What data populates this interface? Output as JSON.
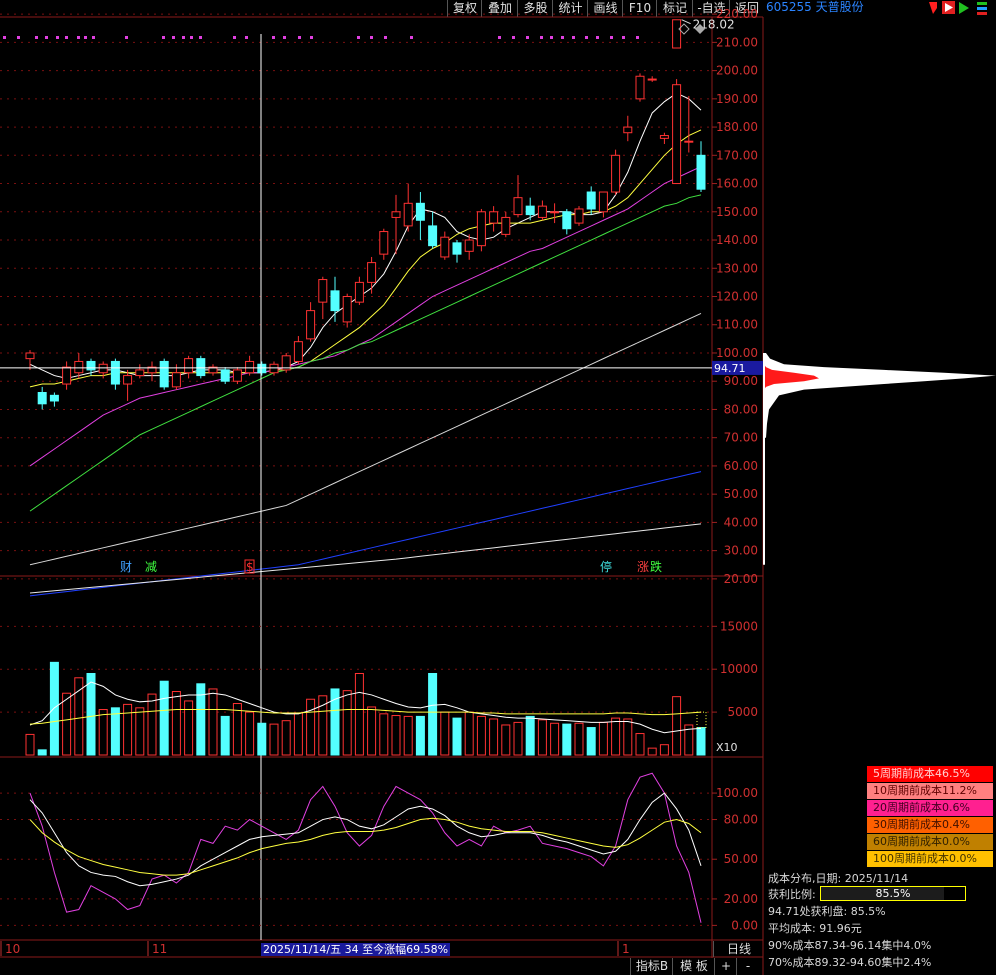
{
  "toolbar": {
    "items": [
      "复权",
      "叠加",
      "多股",
      "统计",
      "画线",
      "F10",
      "标记",
      "-自选",
      "返回"
    ]
  },
  "stock": {
    "code_name": "605255 天普股份"
  },
  "main_chart": {
    "y_ticks": [
      "220.00",
      "210.00",
      "200.00",
      "190.00",
      "180.00",
      "170.00",
      "160.00",
      "150.00",
      "140.00",
      "130.00",
      "120.00",
      "110.00",
      "100.00",
      "90.00",
      "80.00",
      "70.00",
      "60.00",
      "50.00",
      "40.00",
      "30.00",
      "20.00"
    ],
    "high_label": "218.02",
    "current_price_tag": "94.71",
    "event_marks": [
      {
        "text": "财",
        "color": "#40a0ff"
      },
      {
        "text": "减",
        "color": "#40ff40"
      },
      {
        "text": "$",
        "color": "#ff3030"
      },
      {
        "text": "停",
        "color": "#40e0e0"
      },
      {
        "text": "涨",
        "color": "#ff4040"
      },
      {
        "text": "跌",
        "color": "#40ff40"
      }
    ]
  },
  "volume_chart": {
    "y_ticks": [
      "15000",
      "10000",
      "5000"
    ],
    "unit": "X10"
  },
  "indicator_chart": {
    "y_ticks": [
      "100.00",
      "80.00",
      "50.00",
      "20.00",
      "0.00"
    ]
  },
  "x_axis": {
    "labels": [
      "10",
      "11",
      "1"
    ],
    "status_text": "2025/11/14/五 34 至今涨幅69.58%",
    "period": "日线"
  },
  "bottom_tabs": [
    "指标B",
    "模 板",
    "+",
    "-"
  ],
  "cost_distribution": {
    "legend": [
      {
        "label": "5周期前成本46.5%",
        "bg": "#ff0000",
        "fg": "#ffd0d0"
      },
      {
        "label": "10周期前成本11.2%",
        "bg": "#ff8080",
        "fg": "#600000"
      },
      {
        "label": "20周期前成本0.6%",
        "bg": "#ff2090",
        "fg": "#400020"
      },
      {
        "label": "30周期前成本0.4%",
        "bg": "#ff6000",
        "fg": "#401000"
      },
      {
        "label": "60周期前成本0.0%",
        "bg": "#c08000",
        "fg": "#302000"
      },
      {
        "label": "100周期前成本0.0%",
        "bg": "#ffc000",
        "fg": "#403000"
      }
    ],
    "date_line": "成本分布,日期: 2025/11/14",
    "profit_ratio_label": "获利比例:",
    "profit_ratio_value": "85.5%",
    "profit_ratio_fraction": 0.855,
    "profit_at_price": "94.71处获利盘: 85.5%",
    "avg_cost": "平均成本: 91.96元",
    "cost90": "90%成本87.34-96.14集中4.0%",
    "cost70": "70%成本89.32-94.60集中2.4%"
  },
  "chart_data": {
    "type": "candlestick",
    "y_axis_range": [
      15,
      225
    ],
    "candles": [
      {
        "o": 98,
        "c": 100,
        "h": 101,
        "l": 94
      },
      {
        "o": 86,
        "c": 82,
        "h": 88,
        "l": 80
      },
      {
        "o": 85,
        "c": 83,
        "h": 86,
        "l": 81
      },
      {
        "o": 89,
        "c": 95,
        "h": 97,
        "l": 87
      },
      {
        "o": 93,
        "c": 97,
        "h": 100,
        "l": 91
      },
      {
        "o": 97,
        "c": 94,
        "h": 98,
        "l": 92
      },
      {
        "o": 93,
        "c": 96,
        "h": 97,
        "l": 91
      },
      {
        "o": 97,
        "c": 89,
        "h": 98,
        "l": 87
      },
      {
        "o": 89,
        "c": 92,
        "h": 94,
        "l": 83
      },
      {
        "o": 92,
        "c": 94,
        "h": 96,
        "l": 91
      },
      {
        "o": 93,
        "c": 95,
        "h": 97,
        "l": 90
      },
      {
        "o": 97,
        "c": 88,
        "h": 98,
        "l": 87
      },
      {
        "o": 88,
        "c": 93,
        "h": 96,
        "l": 87
      },
      {
        "o": 93,
        "c": 98,
        "h": 99,
        "l": 91
      },
      {
        "o": 98,
        "c": 92,
        "h": 99,
        "l": 91
      },
      {
        "o": 93,
        "c": 95,
        "h": 96,
        "l": 92
      },
      {
        "o": 94,
        "c": 90,
        "h": 95,
        "l": 89
      },
      {
        "o": 90,
        "c": 94,
        "h": 95,
        "l": 89
      },
      {
        "o": 93,
        "c": 97,
        "h": 99,
        "l": 92
      },
      {
        "o": 96,
        "c": 93,
        "h": 97,
        "l": 92
      },
      {
        "o": 93,
        "c": 96,
        "h": 97,
        "l": 92
      },
      {
        "o": 94,
        "c": 99,
        "h": 100,
        "l": 93
      },
      {
        "o": 97,
        "c": 104,
        "h": 106,
        "l": 96
      },
      {
        "o": 105,
        "c": 115,
        "h": 118,
        "l": 104
      },
      {
        "o": 118,
        "c": 126,
        "h": 127,
        "l": 112
      },
      {
        "o": 122,
        "c": 115,
        "h": 127,
        "l": 111
      },
      {
        "o": 111,
        "c": 120,
        "h": 121,
        "l": 109
      },
      {
        "o": 118,
        "c": 125,
        "h": 127,
        "l": 117
      },
      {
        "o": 125,
        "c": 132,
        "h": 134,
        "l": 121
      },
      {
        "o": 135,
        "c": 143,
        "h": 144,
        "l": 133
      },
      {
        "o": 148,
        "c": 150,
        "h": 156,
        "l": 135
      },
      {
        "o": 145,
        "c": 153,
        "h": 160,
        "l": 143
      },
      {
        "o": 153,
        "c": 147,
        "h": 157,
        "l": 140
      },
      {
        "o": 145,
        "c": 138,
        "h": 150,
        "l": 137
      },
      {
        "o": 134,
        "c": 141,
        "h": 143,
        "l": 133
      },
      {
        "o": 139,
        "c": 135,
        "h": 140,
        "l": 132
      },
      {
        "o": 136,
        "c": 140,
        "h": 142,
        "l": 133
      },
      {
        "o": 138,
        "c": 150,
        "h": 151,
        "l": 136
      },
      {
        "o": 146,
        "c": 150,
        "h": 152,
        "l": 143
      },
      {
        "o": 142,
        "c": 148,
        "h": 150,
        "l": 141
      },
      {
        "o": 149,
        "c": 155,
        "h": 163,
        "l": 148
      },
      {
        "o": 152,
        "c": 149,
        "h": 155,
        "l": 147
      },
      {
        "o": 148,
        "c": 152,
        "h": 154,
        "l": 147
      },
      {
        "o": 150,
        "c": 150,
        "h": 153,
        "l": 146
      },
      {
        "o": 150,
        "c": 144,
        "h": 151,
        "l": 142
      },
      {
        "o": 146,
        "c": 151,
        "h": 152,
        "l": 145
      },
      {
        "o": 157,
        "c": 151,
        "h": 159,
        "l": 149
      },
      {
        "o": 150,
        "c": 157,
        "h": 157,
        "l": 148
      },
      {
        "o": 157,
        "c": 170,
        "h": 172,
        "l": 156
      },
      {
        "o": 178,
        "c": 180,
        "h": 184,
        "l": 175
      },
      {
        "o": 190,
        "c": 198,
        "h": 199,
        "l": 189
      },
      {
        "o": 197,
        "c": 197,
        "h": 198,
        "l": 196
      },
      {
        "o": 176,
        "c": 177,
        "h": 178,
        "l": 174
      },
      {
        "o": 160,
        "c": 195,
        "h": 197,
        "l": 160
      },
      {
        "o": 175,
        "c": 175,
        "h": 191,
        "l": 171
      },
      {
        "o": 170,
        "c": 158,
        "h": 175,
        "l": 157
      }
    ],
    "high_marker": {
      "x_index": 53,
      "price": 218.02,
      "o": 208,
      "c": 218
    },
    "ma_lines": [
      {
        "name": "MA5",
        "color": "#ffffff",
        "values": [
          96,
          94,
          92,
          91,
          92,
          93,
          94,
          94,
          93,
          92,
          92,
          92,
          92,
          93,
          94,
          94,
          94,
          93,
          93,
          93,
          94,
          95,
          97,
          102,
          109,
          114,
          117,
          120,
          123,
          128,
          136,
          145,
          151,
          150,
          148,
          143,
          141,
          140,
          141,
          144,
          146,
          148,
          150,
          150,
          150,
          149,
          149,
          150,
          156,
          164,
          175,
          185,
          189,
          192,
          190,
          186
        ]
      },
      {
        "name": "MA10",
        "color": "#ffff40",
        "values": [
          88,
          89,
          89,
          90,
          91,
          92,
          92,
          93,
          93,
          93,
          93,
          93,
          93,
          93,
          93,
          93,
          93,
          93,
          93,
          93,
          94,
          94,
          95,
          97,
          100,
          103,
          106,
          109,
          113,
          117,
          123,
          129,
          134,
          137,
          139,
          142,
          144,
          145,
          146,
          146,
          146,
          146,
          147,
          148,
          149,
          149,
          150,
          150,
          152,
          155,
          160,
          165,
          170,
          174,
          177,
          179
        ]
      },
      {
        "name": "MA20",
        "color": "#e040e0",
        "values": [
          60,
          63,
          66,
          69,
          72,
          75,
          78,
          80,
          82,
          84,
          85,
          86,
          87,
          88,
          89,
          90,
          91,
          92,
          93,
          93,
          94,
          95,
          96,
          97,
          98,
          99,
          101,
          103,
          105,
          108,
          111,
          114,
          117,
          120,
          122,
          124,
          126,
          128,
          130,
          132,
          134,
          136,
          137,
          139,
          141,
          143,
          145,
          147,
          149,
          151,
          154,
          157,
          160,
          162,
          164,
          166
        ]
      },
      {
        "name": "MA30",
        "color": "#40e040",
        "values": [
          44,
          47,
          50,
          53,
          56,
          59,
          62,
          65,
          68,
          71,
          73,
          75,
          77,
          79,
          81,
          83,
          85,
          87,
          89,
          91,
          93,
          94,
          95,
          97,
          98,
          100,
          101,
          103,
          104,
          106,
          108,
          110,
          112,
          114,
          116,
          118,
          120,
          122,
          124,
          126,
          128,
          130,
          132,
          134,
          136,
          138,
          140,
          142,
          144,
          146,
          148,
          150,
          152,
          153,
          155,
          156
        ]
      },
      {
        "name": "MA60",
        "color": "#d8d8d8",
        "values": [
          25,
          26,
          27,
          28,
          29,
          30,
          31,
          32,
          33,
          34,
          35,
          36,
          37,
          38,
          39,
          40,
          41,
          42,
          43,
          44,
          45,
          46,
          48,
          50,
          52,
          54,
          56,
          58,
          60,
          62,
          64,
          66,
          68,
          70,
          72,
          74,
          76,
          78,
          80,
          82,
          84,
          86,
          88,
          90,
          92,
          94,
          96,
          98,
          100,
          102,
          104,
          106,
          108,
          110,
          112,
          114
        ]
      },
      {
        "name": "MA120",
        "color": "#2040ff",
        "values": [
          14,
          14.5,
          15,
          15.5,
          16,
          16.5,
          17,
          17.5,
          18,
          18.5,
          19,
          19.5,
          20,
          20.5,
          21,
          21.5,
          22,
          22.5,
          23,
          23.5,
          24,
          24.5,
          25,
          26,
          27,
          28,
          29,
          30,
          31,
          32,
          33,
          34,
          35,
          36,
          37,
          38,
          39,
          40,
          41,
          42,
          43,
          44,
          45,
          46,
          47,
          48,
          49,
          50,
          51,
          52,
          53,
          54,
          55,
          56,
          57,
          58
        ]
      },
      {
        "name": "MA250",
        "color": "#e8e8e8",
        "values": [
          15,
          15.4,
          15.8,
          16.2,
          16.6,
          17,
          17.4,
          17.8,
          18.2,
          18.6,
          19,
          19.4,
          19.8,
          20.2,
          20.6,
          21,
          21.4,
          21.8,
          22.2,
          22.6,
          23,
          23.4,
          23.8,
          24.2,
          24.6,
          25,
          25.4,
          25.8,
          26.2,
          26.6,
          27,
          27.5,
          28,
          28.5,
          29,
          29.5,
          30,
          30.5,
          31,
          31.5,
          32,
          32.5,
          33,
          33.5,
          34,
          34.5,
          35,
          35.5,
          36,
          36.5,
          37,
          37.5,
          38,
          38.5,
          39,
          39.5
        ]
      }
    ],
    "volume": {
      "y_axis_range": [
        0,
        19000
      ],
      "bars": [
        2400,
        600,
        10800,
        7200,
        9000,
        9500,
        5300,
        5500,
        5900,
        5500,
        7100,
        8600,
        7400,
        6300,
        8300,
        7700,
        4500,
        6000,
        5000,
        3700,
        3600,
        4000,
        4900,
        6500,
        6900,
        7700,
        7500,
        9500,
        5600,
        4800,
        4600,
        4500,
        4500,
        9500,
        5000,
        4300,
        5000,
        4500,
        4200,
        3500,
        3800,
        4500,
        4100,
        3700,
        3600,
        3700,
        3200,
        3800,
        4300,
        4200,
        2500,
        800,
        1200,
        6800,
        3500,
        3200
      ],
      "ma_white": [
        3500,
        4000,
        5500,
        6500,
        7500,
        8500,
        8000,
        7000,
        6500,
        6200,
        6300,
        6600,
        6800,
        7000,
        7000,
        7200,
        7000,
        6500,
        6000,
        5500,
        5000,
        4800,
        4800,
        5200,
        5800,
        6500,
        7000,
        7300,
        7000,
        6500,
        6000,
        5600,
        5500,
        5800,
        5900,
        5500,
        5000,
        4800,
        4600,
        4400,
        4300,
        4300,
        4200,
        4100,
        4000,
        3900,
        3800,
        3800,
        3900,
        3900,
        3600,
        3000,
        2600,
        2800,
        3000,
        3100
      ],
      "ma_yellow": [
        3600,
        3700,
        3900,
        4100,
        4300,
        4500,
        4700,
        4800,
        4900,
        5000,
        5100,
        5200,
        5300,
        5300,
        5300,
        5300,
        5300,
        5200,
        5100,
        5000,
        4900,
        4900,
        4900,
        5000,
        5100,
        5200,
        5300,
        5300,
        5300,
        5200,
        5100,
        5000,
        5000,
        5000,
        5000,
        5000,
        5000,
        4900,
        4900,
        4800,
        4800,
        4800,
        4800,
        4800,
        4800,
        4800,
        4800,
        4800,
        4900,
        4900,
        4800,
        4700,
        4700,
        4800,
        4900,
        5000
      ]
    },
    "indicator": {
      "y_axis_range": [
        -5,
        125
      ],
      "magenta": [
        100,
        75,
        40,
        10,
        12,
        30,
        25,
        20,
        12,
        15,
        35,
        38,
        32,
        40,
        65,
        62,
        75,
        72,
        80,
        75,
        70,
        65,
        72,
        95,
        105,
        90,
        70,
        60,
        68,
        90,
        105,
        100,
        95,
        85,
        70,
        60,
        65,
        60,
        75,
        70,
        72,
        75,
        62,
        60,
        58,
        55,
        52,
        45,
        60,
        95,
        112,
        115,
        100,
        60,
        40,
        2
      ],
      "white": [
        95,
        85,
        70,
        55,
        45,
        40,
        38,
        37,
        33,
        30,
        31,
        33,
        35,
        38,
        45,
        50,
        55,
        60,
        65,
        67,
        68,
        69,
        70,
        75,
        80,
        82,
        80,
        75,
        73,
        76,
        82,
        88,
        90,
        88,
        83,
        75,
        70,
        67,
        68,
        70,
        70,
        70,
        68,
        65,
        63,
        60,
        57,
        54,
        56,
        65,
        80,
        93,
        100,
        88,
        72,
        45
      ],
      "yellow": [
        80,
        70,
        63,
        57,
        52,
        49,
        46,
        44,
        42,
        40,
        39,
        38,
        38,
        39,
        42,
        45,
        48,
        51,
        55,
        58,
        60,
        62,
        63,
        65,
        68,
        70,
        71,
        71,
        71,
        72,
        74,
        77,
        80,
        81,
        80,
        78,
        75,
        73,
        72,
        71,
        71,
        71,
        70,
        68,
        66,
        64,
        62,
        60,
        59,
        61,
        66,
        72,
        78,
        80,
        77,
        70
      ]
    }
  }
}
